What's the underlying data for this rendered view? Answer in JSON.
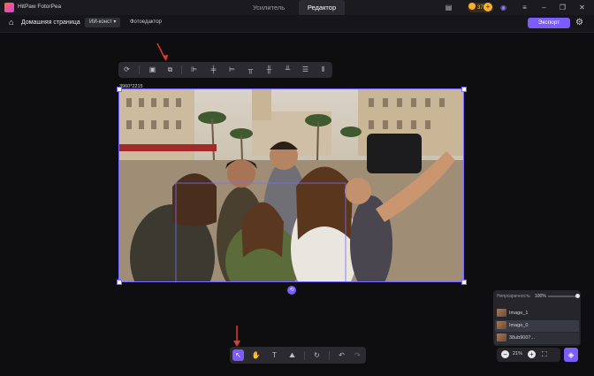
{
  "app": {
    "name": "HitPaw FotorPea"
  },
  "tabs": [
    {
      "label": "Усилитель"
    },
    {
      "label": "Редактор"
    }
  ],
  "header": {
    "credits": "3733"
  },
  "navbar": {
    "home_label": "Домашняя страница",
    "ai_tag": "ИИ-конст",
    "photo_label": "Фотоедактор",
    "export_label": "Экспорт"
  },
  "canvas": {
    "dimensions": "3960*2215"
  },
  "layers_panel": {
    "opacity_label": "Непрозрачность",
    "opacity_value": "100%",
    "opacity_level": 1.0,
    "layers": [
      {
        "name": "Image_1"
      },
      {
        "name": "Image_0"
      },
      {
        "name": "38ub9007..."
      }
    ]
  },
  "zoom": {
    "value": "21%"
  },
  "colors": {
    "accent": "#7b5cff",
    "background": "#0e0e10",
    "arrow": "#e23a2e"
  },
  "icons": {
    "top_toolbar": [
      "rotate-crop-icon",
      "select-image-icon",
      "duplicate-icon",
      "align-left-icon",
      "align-center-h-icon",
      "align-right-icon",
      "align-top-icon",
      "align-center-v-icon",
      "align-bottom-icon",
      "distribute-h-icon",
      "distribute-v-icon"
    ],
    "bottom_toolbar": [
      "select-pointer-icon",
      "hand-icon",
      "text-icon",
      "image-icon",
      "redo-rotate-icon",
      "undo-icon",
      "redo-icon"
    ]
  }
}
